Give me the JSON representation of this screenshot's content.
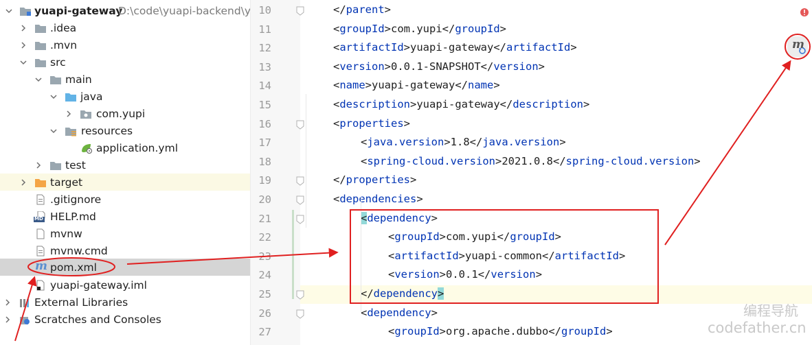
{
  "project_tree": {
    "root": {
      "name": "yuapi-gateway",
      "path": "D:\\code\\yuapi-backend\\yu"
    },
    "items": [
      {
        "label": ".idea"
      },
      {
        "label": ".mvn"
      },
      {
        "label": "src"
      },
      {
        "label": "main"
      },
      {
        "label": "java"
      },
      {
        "label": "com.yupi"
      },
      {
        "label": "resources"
      },
      {
        "label": "application.yml"
      },
      {
        "label": "test"
      },
      {
        "label": "target"
      },
      {
        "label": ".gitignore"
      },
      {
        "label": "HELP.md"
      },
      {
        "label": "mvnw"
      },
      {
        "label": "mvnw.cmd"
      },
      {
        "label": "pom.xml"
      },
      {
        "label": "yuapi-gateway.iml"
      },
      {
        "label": "External Libraries"
      },
      {
        "label": "Scratches and Consoles"
      }
    ],
    "md_badge": "MD"
  },
  "editor": {
    "line_numbers": [
      "10",
      "11",
      "12",
      "13",
      "14",
      "15",
      "16",
      "17",
      "18",
      "19",
      "20",
      "21",
      "22",
      "23",
      "24",
      "25",
      "26",
      "27"
    ],
    "lines": [
      {
        "o": "</",
        "t": "parent",
        "c": ">",
        "v": "",
        "o2": "",
        "t2": "",
        "c2": ""
      },
      {
        "o": "<",
        "t": "groupId",
        "c": ">",
        "v": "com.yupi",
        "o2": "</",
        "t2": "groupId",
        "c2": ">"
      },
      {
        "o": "<",
        "t": "artifactId",
        "c": ">",
        "v": "yuapi-gateway",
        "o2": "</",
        "t2": "artifactId",
        "c2": ">"
      },
      {
        "o": "<",
        "t": "version",
        "c": ">",
        "v": "0.0.1-SNAPSHOT",
        "o2": "</",
        "t2": "version",
        "c2": ">"
      },
      {
        "o": "<",
        "t": "name",
        "c": ">",
        "v": "yuapi-gateway",
        "o2": "</",
        "t2": "name",
        "c2": ">"
      },
      {
        "o": "<",
        "t": "description",
        "c": ">",
        "v": "yuapi-gateway",
        "o2": "</",
        "t2": "description",
        "c2": ">"
      },
      {
        "o": "<",
        "t": "properties",
        "c": ">",
        "v": "",
        "o2": "",
        "t2": "",
        "c2": ""
      },
      {
        "o": "<",
        "t": "java.version",
        "c": ">",
        "v": "1.8",
        "o2": "</",
        "t2": "java.version",
        "c2": ">"
      },
      {
        "o": "<",
        "t": "spring-cloud.version",
        "c": ">",
        "v": "2021.0.8",
        "o2": "</",
        "t2": "spring-cloud.version",
        "c2": ">"
      },
      {
        "o": "</",
        "t": "properties",
        "c": ">",
        "v": "",
        "o2": "",
        "t2": "",
        "c2": ""
      },
      {
        "o": "<",
        "t": "dependencies",
        "c": ">",
        "v": "",
        "o2": "",
        "t2": "",
        "c2": ""
      },
      {
        "o": "<",
        "t": "dependency",
        "c": ">",
        "v": "",
        "o2": "",
        "t2": "",
        "c2": ""
      },
      {
        "o": "<",
        "t": "groupId",
        "c": ">",
        "v": "com.yupi",
        "o2": "</",
        "t2": "groupId",
        "c2": ">"
      },
      {
        "o": "<",
        "t": "artifactId",
        "c": ">",
        "v": "yuapi-common",
        "o2": "</",
        "t2": "artifactId",
        "c2": ">"
      },
      {
        "o": "<",
        "t": "version",
        "c": ">",
        "v": "0.0.1",
        "o2": "</",
        "t2": "version",
        "c2": ">"
      },
      {
        "o": "</",
        "t": "dependency",
        "c": ">",
        "v": "",
        "o2": "",
        "t2": "",
        "c2": ""
      },
      {
        "o": "<",
        "t": "dependency",
        "c": ">",
        "v": "",
        "o2": "",
        "t2": "",
        "c2": ""
      },
      {
        "o": "<",
        "t": "groupId",
        "c": ">",
        "v": "org.apache.dubbo",
        "o2": "</",
        "t2": "groupId",
        "c2": ">"
      }
    ],
    "maven_reload_icon": "m"
  },
  "watermark": {
    "line1": "编程导航",
    "line2": "codefather.cn"
  },
  "colors": {
    "tag": "#0033b3",
    "annotation": "#e02020",
    "folder": "#9aa7b0",
    "java_folder": "#62b3e6",
    "target_folder": "#f4a546"
  }
}
